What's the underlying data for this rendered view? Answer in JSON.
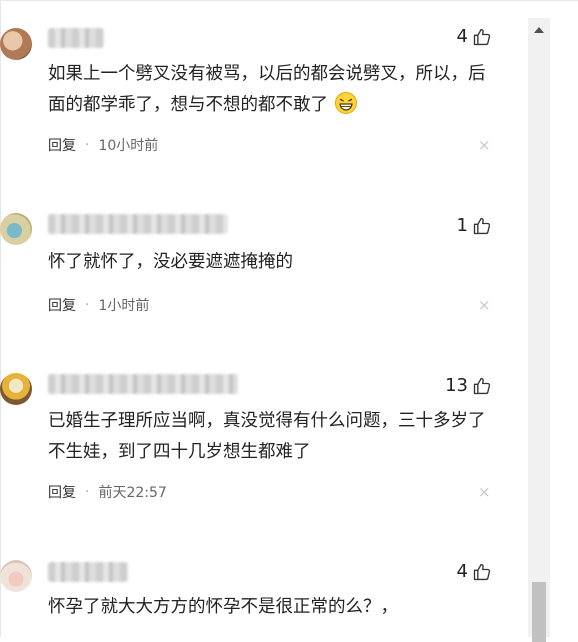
{
  "comments": [
    {
      "likes": "4",
      "text": "如果上一个劈叉没有被骂，以后的都会说劈叉，所以，后面的都学乖了，想与不想的都不敢了",
      "emoji": "grinning-emoji",
      "reply_label": "回复",
      "time": "10小时前"
    },
    {
      "likes": "1",
      "text": "怀了就怀了，没必要遮遮掩掩的",
      "reply_label": "回复",
      "time": "1小时前"
    },
    {
      "likes": "13",
      "text": "已婚生子理所应当啊，真没觉得有什么问题，三十多岁了不生娃，到了四十几岁想生都难了",
      "reply_label": "回复",
      "time": "前天22:57"
    },
    {
      "likes": "4",
      "text": "怀孕了就大大方方的怀孕不是很正常的么？，"
    }
  ],
  "icons": {
    "like": "thumbs-up-icon",
    "close": "close-icon",
    "scroll_up": "scroll-up-arrow-icon"
  },
  "close_glyph": "×",
  "separator_glyph": "·"
}
